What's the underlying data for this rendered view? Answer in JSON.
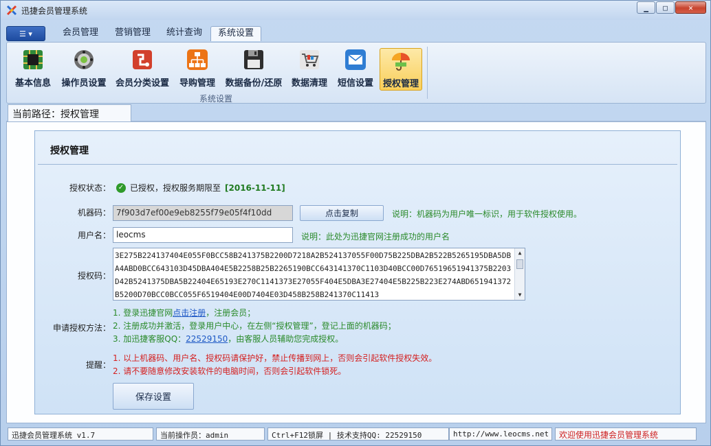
{
  "window": {
    "title": "迅捷会员管理系统"
  },
  "ribbon": {
    "tabs": [
      {
        "label": "会员管理"
      },
      {
        "label": "营销管理"
      },
      {
        "label": "统计查询"
      },
      {
        "label": "系统设置"
      }
    ],
    "group_label": "系统设置",
    "items": [
      {
        "label": "基本信息",
        "icon": "circuit-board-icon"
      },
      {
        "label": "操作员设置",
        "icon": "gear-wheel-icon"
      },
      {
        "label": "会员分类设置",
        "icon": "sitemap-icon"
      },
      {
        "label": "导购管理",
        "icon": "org-chart-icon"
      },
      {
        "label": "数据备份/还原",
        "icon": "floppy-disk-icon"
      },
      {
        "label": "数据清理",
        "icon": "shopping-cart-icon"
      },
      {
        "label": "短信设置",
        "icon": "envelope-icon"
      },
      {
        "label": "授权管理",
        "icon": "umbrella-icon"
      }
    ]
  },
  "breadcrumb": {
    "label": "当前路径：授权管理"
  },
  "panel": {
    "title": "授权管理",
    "status_label": "授权状态：",
    "status_text": "已授权，授权服务期限至",
    "status_date": "[2016-11-11]",
    "machine_code_label": "机器码：",
    "machine_code_value": "7f903d7ef00e9eb8255f79e05f4f10dd",
    "copy_button": "点击复制",
    "machine_code_note": "说明：机器码为用户唯一标识，用于软件授权使用。",
    "username_label": "用户名：",
    "username_value": "leocms",
    "username_note": "说明：此处为迅捷官网注册成功的用户名",
    "auth_code_label": "授权码：",
    "auth_code_value": "3E275B224137404E055F0BCC58B241375B2200D7218A2B524137055F00D75B225DBA2B522B5265195DBA5DBA4ABD0BCC643103D45DBA404E5B2258B25B2265190BCC643141370C1103D40BCC00D76519651941375B2203D42B5241375DBA5B22404E65193E270C1141373E27055F404E5DBA3E27404E5B225B223E274ABD651941372B5200D70BCC0BCC055F6519404E00D7404E03D458B258B241370C11413",
    "apply_label": "申请授权方法：",
    "steps": {
      "s1_pre": "1. 登录迅捷官网",
      "s1_link": "点击注册",
      "s1_post": "，注册会员；",
      "s2": "2. 注册成功并激活，登录用户中心，在左侧“授权管理”，登记上面的机器码；",
      "s3_pre": "3. 加迅捷客服QQ：",
      "s3_link": "22529150",
      "s3_post": "，由客服人员辅助您完成授权。"
    },
    "remind_label": "提醒：",
    "warn1": "1. 以上机器码、用户名、授权码请保护好，禁止传播到网上，否则会引起软件授权失效。",
    "warn2": "2. 请不要随意修改安装软件的电脑时间，否则会引起软件锁死。",
    "save_button": "保存设置"
  },
  "statusbar": {
    "app": "迅捷会员管理系统 v1.7",
    "operator": "当前操作员：admin",
    "hotkey": "Ctrl+F12锁屏 | 技术支持QQ: 22529150",
    "url": "http://www.leocms.net",
    "welcome": "欢迎使用迅捷会员管理系统"
  }
}
